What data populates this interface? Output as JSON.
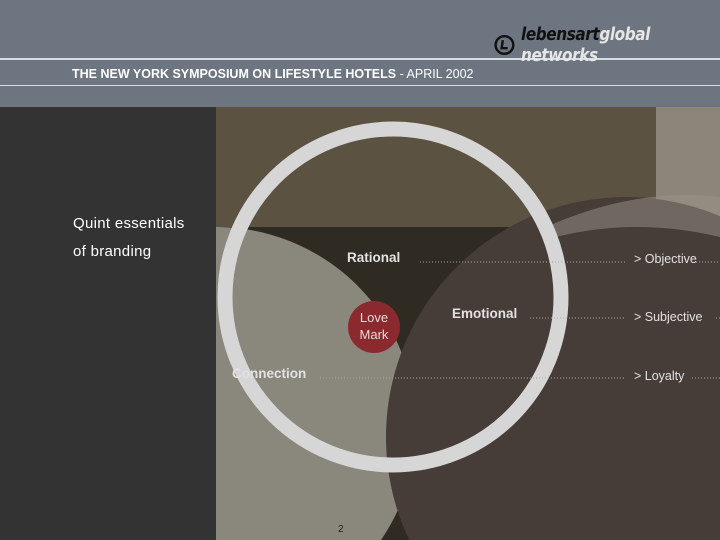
{
  "header": {
    "title_bold": "THE NEW YORK SYMPOSIUM ON LIFESTYLE HOTELS",
    "title_rest": " - APRIL 2002",
    "logo": {
      "brand": "lebensart",
      "suffix": "global networks"
    }
  },
  "slide": {
    "heading_line1": "Quint essentials",
    "heading_line2": "of branding",
    "page_number": "2"
  },
  "diagram": {
    "center": {
      "line1": "Love",
      "line2": "Mark"
    },
    "segments": [
      {
        "label": "Rational",
        "outcome": "> Objective"
      },
      {
        "label": "Emotional",
        "outcome": "> Subjective"
      },
      {
        "label": "Connection",
        "outcome": "> Loyalty"
      }
    ],
    "colors": {
      "center": "#8a2a2e",
      "ring": "#d6d6d6"
    }
  }
}
